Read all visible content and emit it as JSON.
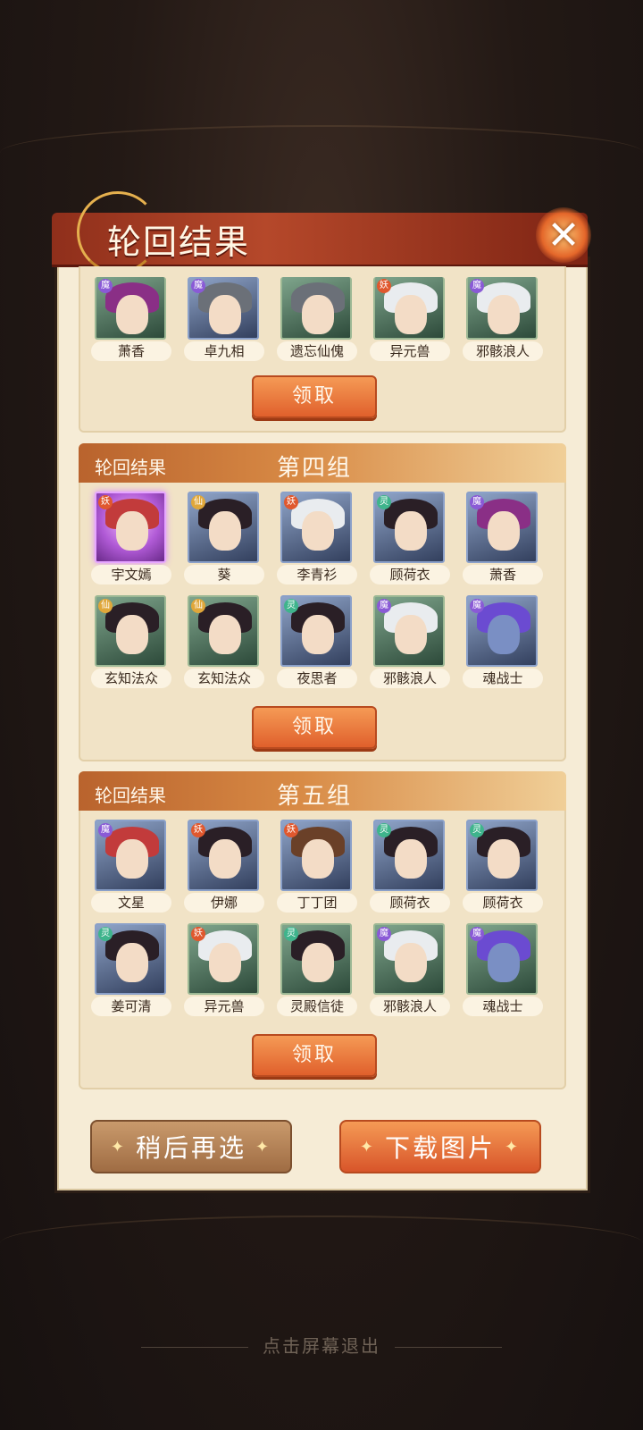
{
  "dialog": {
    "title": "轮回结果",
    "close_icon": "✕"
  },
  "groups": [
    {
      "id": "partial",
      "heroes": [
        {
          "name": "萧香",
          "faction": "魔",
          "hair": "purple",
          "bg": "green"
        },
        {
          "name": "卓九相",
          "faction": "魔",
          "hair": "grey",
          "bg": "blue"
        },
        {
          "name": "遗忘仙傀",
          "faction": "",
          "hair": "grey",
          "bg": "green"
        },
        {
          "name": "异元兽",
          "faction": "妖",
          "hair": "white",
          "bg": "green"
        },
        {
          "name": "邪骸浪人",
          "faction": "魔",
          "hair": "white",
          "bg": "green"
        }
      ],
      "claim_label": "领取"
    },
    {
      "id": "group-4",
      "label": "轮回结果",
      "name": "第四组",
      "heroes": [
        {
          "name": "宇文嫣",
          "faction": "妖",
          "hair": "red",
          "bg": "purple"
        },
        {
          "name": "葵",
          "faction": "仙",
          "hair": "dark",
          "bg": "blue"
        },
        {
          "name": "李青衫",
          "faction": "妖",
          "hair": "white",
          "bg": "blue"
        },
        {
          "name": "顾荷衣",
          "faction": "灵",
          "hair": "dark",
          "bg": "blue"
        },
        {
          "name": "萧香",
          "faction": "魔",
          "hair": "purple",
          "bg": "blue"
        },
        {
          "name": "玄知法众",
          "faction": "仙",
          "hair": "dark",
          "bg": "green"
        },
        {
          "name": "玄知法众",
          "faction": "仙",
          "hair": "dark",
          "bg": "green"
        },
        {
          "name": "夜思者",
          "faction": "灵",
          "hair": "dark",
          "bg": "blue"
        },
        {
          "name": "邪骸浪人",
          "faction": "魔",
          "hair": "white",
          "bg": "green"
        },
        {
          "name": "魂战士",
          "faction": "魔",
          "hair": "violet",
          "bg": "blue"
        }
      ],
      "claim_label": "领取"
    },
    {
      "id": "group-5",
      "label": "轮回结果",
      "name": "第五组",
      "heroes": [
        {
          "name": "文星",
          "faction": "魔",
          "hair": "red",
          "bg": "blue"
        },
        {
          "name": "伊娜",
          "faction": "妖",
          "hair": "dark",
          "bg": "blue"
        },
        {
          "name": "丁丁团",
          "faction": "妖",
          "hair": "brown",
          "bg": "blue"
        },
        {
          "name": "顾荷衣",
          "faction": "灵",
          "hair": "dark",
          "bg": "blue"
        },
        {
          "name": "顾荷衣",
          "faction": "灵",
          "hair": "dark",
          "bg": "blue"
        },
        {
          "name": "姜可清",
          "faction": "灵",
          "hair": "dark",
          "bg": "blue"
        },
        {
          "name": "异元兽",
          "faction": "妖",
          "hair": "white",
          "bg": "green"
        },
        {
          "name": "灵殿信徒",
          "faction": "灵",
          "hair": "dark",
          "bg": "green"
        },
        {
          "name": "邪骸浪人",
          "faction": "魔",
          "hair": "white",
          "bg": "green"
        },
        {
          "name": "魂战士",
          "faction": "魔",
          "hair": "violet",
          "bg": "green"
        }
      ],
      "claim_label": "领取"
    }
  ],
  "actions": {
    "later_label": "稍后再选",
    "download_label": "下载图片",
    "spark_icon": "✦"
  },
  "exit_hint": "点击屏幕退出",
  "colors": {
    "accent": "#e0602c",
    "title_bar": "#a63f23",
    "panel": "#f6ecd6"
  }
}
